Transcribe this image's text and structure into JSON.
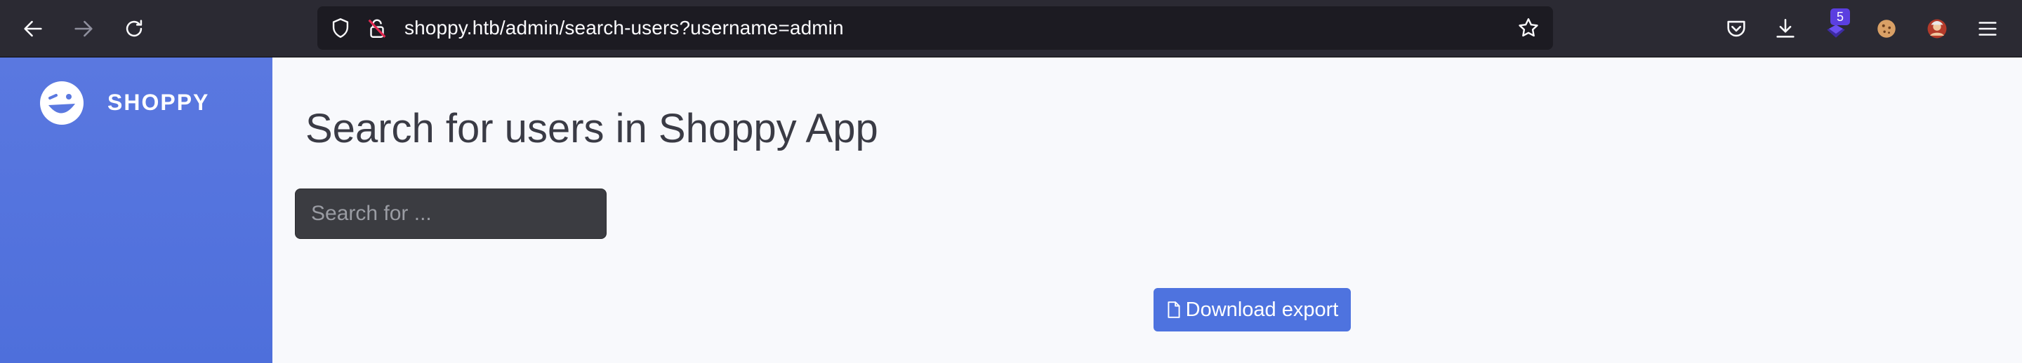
{
  "browser": {
    "url": "shoppy.htb/admin/search-users?username=admin",
    "extension_badge_count": "5",
    "icons": [
      "back-arrow-icon",
      "forward-arrow-icon",
      "reload-icon",
      "shield-icon",
      "lock-warning-icon",
      "star-bookmark-icon",
      "pocket-icon",
      "download-icon",
      "extension-icon",
      "cookie-icon",
      "avatar-icon",
      "hamburger-menu-icon"
    ]
  },
  "sidebar": {
    "brand_name": "SHOPPY",
    "brand_icon": "laughing-wink-icon"
  },
  "main": {
    "title": "Search for users in Shoppy App",
    "search_placeholder": "Search for ...",
    "search_value": "",
    "export_button_label": "Download export",
    "export_icon": "file-icon"
  },
  "colors": {
    "accent": "#4e73df",
    "sidebar": "#5a78e0",
    "browser_toolbar": "#2b2a33",
    "page_bg": "#f8f9fc"
  }
}
